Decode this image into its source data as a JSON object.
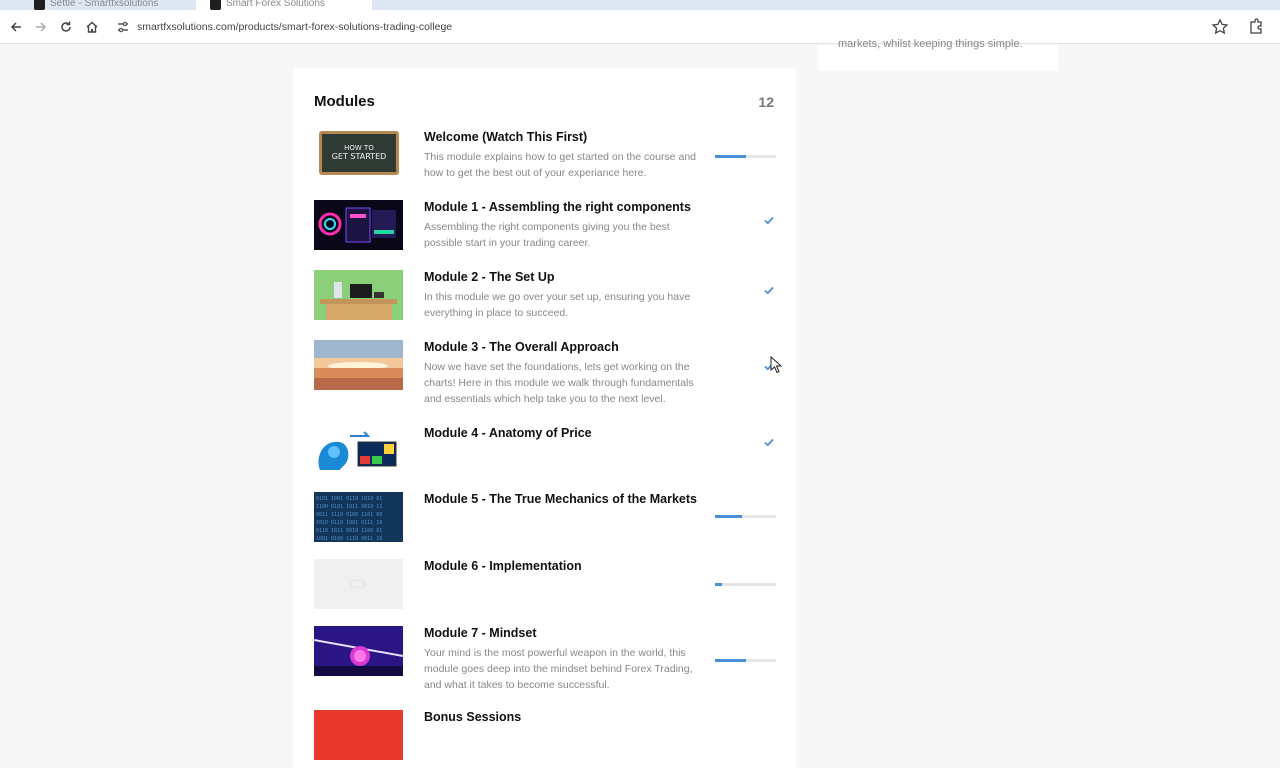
{
  "browser": {
    "tabs": [
      {
        "title": "Settle - Smartfxsolutions"
      },
      {
        "title": "Smart Forex Solutions"
      }
    ],
    "url": "smartfxsolutions.com/products/smart-forex-solutions-trading-college"
  },
  "sidebar_card": {
    "text": "markets, whilst keeping things simple."
  },
  "modules_section": {
    "title": "Modules",
    "count": "12",
    "items": [
      {
        "title": "Welcome (Watch This First)",
        "description": "This module explains how to get started on the course and how to get the best out of your experiance here.",
        "status": "progress",
        "progress": 0.5,
        "thumb": "chalkboard"
      },
      {
        "title": "Module 1 - Assembling the right components",
        "description": "Assembling the right components giving you the best possible start in your trading career.",
        "status": "complete",
        "thumb": "gaming-pc"
      },
      {
        "title": "Module 2 - The Set Up",
        "description": "In this module we go over your set up, ensuring you have everything in place to succeed.",
        "status": "complete",
        "thumb": "desk-setup"
      },
      {
        "title": "Module 3 - The Overall Approach",
        "description": "Now we have set the foundations, lets get working on the charts! Here in this module we walk through fundamentals and essentials which help take you to the next level.",
        "status": "complete",
        "thumb": "sunset-clouds"
      },
      {
        "title": "Module 4 - Anatomy of Price",
        "description": "",
        "status": "complete",
        "thumb": "brain-chart"
      },
      {
        "title": "Module 5 - The True Mechanics of the Markets",
        "description": "",
        "status": "progress",
        "progress": 0.45,
        "thumb": "binary-code"
      },
      {
        "title": "Module 6 - Implementation",
        "description": "",
        "status": "progress",
        "progress": 0.12,
        "thumb": "blank"
      },
      {
        "title": "Module 7 - Mindset",
        "description": "Your mind is the most powerful weapon in the world, this module goes deep into the mindset behind Forex Trading, and what it takes to become successful.",
        "status": "progress",
        "progress": 0.5,
        "thumb": "purple-brain"
      },
      {
        "title": "Bonus Sessions",
        "description": "",
        "status": "none",
        "thumb": "red-banner"
      }
    ]
  },
  "thumb_text": {
    "chalkboard": "HOW TO GET STARTED"
  },
  "colors": {
    "accent": "#4a8fd8",
    "check": "#4a8fd8"
  }
}
